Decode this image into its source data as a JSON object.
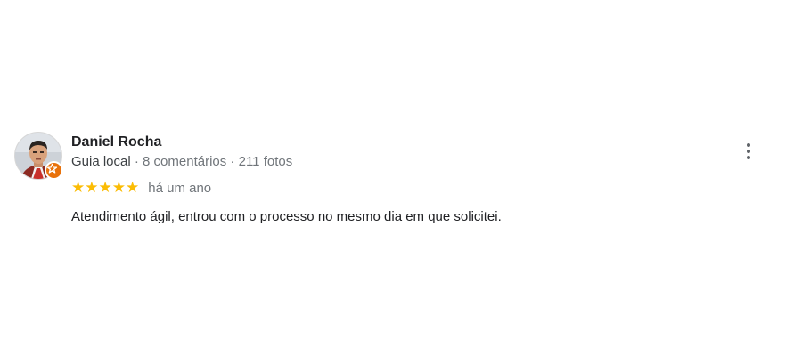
{
  "review": {
    "author": {
      "name": "Daniel Rocha",
      "guide_label": "Guia local",
      "separator": " · ",
      "reviews_count": "8 comentários",
      "photos_count": "211 fotos",
      "badge_icon": "local-guide-star-icon",
      "badge_color": "#e8710a"
    },
    "rating": {
      "stars": 5,
      "max_stars": 5,
      "star_glyph": "★",
      "star_color": "#fbbc04"
    },
    "time_ago": "há um ano",
    "text": "Atendimento ágil, entrou com o processo no mesmo dia em que solicitei.",
    "menu_icon": "more-vert-icon"
  }
}
